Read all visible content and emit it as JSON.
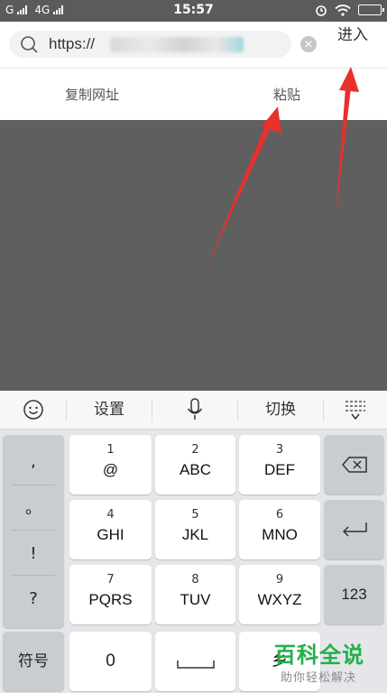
{
  "status_bar": {
    "carrier1": "G",
    "carrier2": "4G",
    "time": "15:57"
  },
  "address_bar": {
    "url_prefix": "https://",
    "enter_label": "进入"
  },
  "paste_bar": {
    "copy_label": "复制网址",
    "paste_label": "粘贴"
  },
  "keyboard": {
    "toolbar": {
      "emoji_icon": "smiley-icon",
      "settings_label": "设置",
      "mic_icon": "microphone-icon",
      "switch_label": "切换",
      "collapse_icon": "keyboard-collapse-icon"
    },
    "punctuation": [
      ",",
      "。",
      "!",
      "?"
    ],
    "keys": [
      {
        "num": "1",
        "letters": "@"
      },
      {
        "num": "2",
        "letters": "ABC"
      },
      {
        "num": "3",
        "letters": "DEF"
      },
      {
        "num": "4",
        "letters": "GHI"
      },
      {
        "num": "5",
        "letters": "JKL"
      },
      {
        "num": "6",
        "letters": "MNO"
      },
      {
        "num": "7",
        "letters": "PQRS"
      },
      {
        "num": "8",
        "letters": "TUV"
      },
      {
        "num": "9",
        "letters": "WXYZ"
      }
    ],
    "symbols_label": "符号",
    "zero_label": "0",
    "num_switch_label": "123",
    "partial_key_label": "乡"
  },
  "watermark": {
    "big": "百科全说",
    "small": "助你轻松解决"
  },
  "colors": {
    "arrow": "#e8302c",
    "watermark_green": "#23b04a",
    "overlay": "#5f5f5f"
  }
}
